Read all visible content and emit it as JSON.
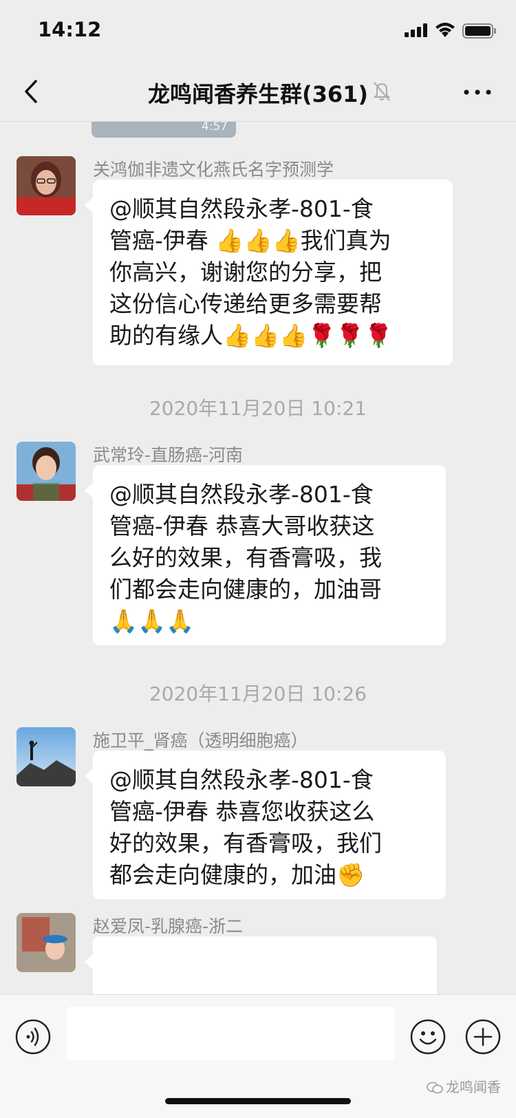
{
  "status_bar": {
    "time": "14:12"
  },
  "nav": {
    "title": "龙鸣闻香养生群(361)"
  },
  "video": {
    "duration": "4:57"
  },
  "messages": [
    {
      "sender": "关鸿伽非遗文化燕氏名字预测学",
      "text": "@顺其自然段永孝-801-食\n管癌-伊春 👍👍👍我们真为\n你高兴，谢谢您的分享，把\n这份信心传递给更多需要帮\n助的有缘人👍👍👍🌹🌹🌹"
    },
    {
      "sender": "武常玲-直肠癌-河南",
      "text": "@顺其自然段永孝-801-食\n管癌-伊春 恭喜大哥收获这\n么好的效果，有香膏吸，我\n们都会走向健康的，加油哥\n🙏🙏🙏"
    },
    {
      "sender": "施卫平_肾癌（透明细胞癌）",
      "text": "@顺其自然段永孝-801-食\n管癌-伊春 恭喜您收获这么\n好的效果，有香膏吸，我们\n都会走向健康的，加油✊"
    },
    {
      "sender": "赵爱凤-乳腺癌-浙二",
      "text": ""
    }
  ],
  "timestamps": [
    "2020年11月20日 10:21",
    "2020年11月20日 10:26"
  ],
  "watermark": {
    "text": "龙鸣闻香"
  }
}
